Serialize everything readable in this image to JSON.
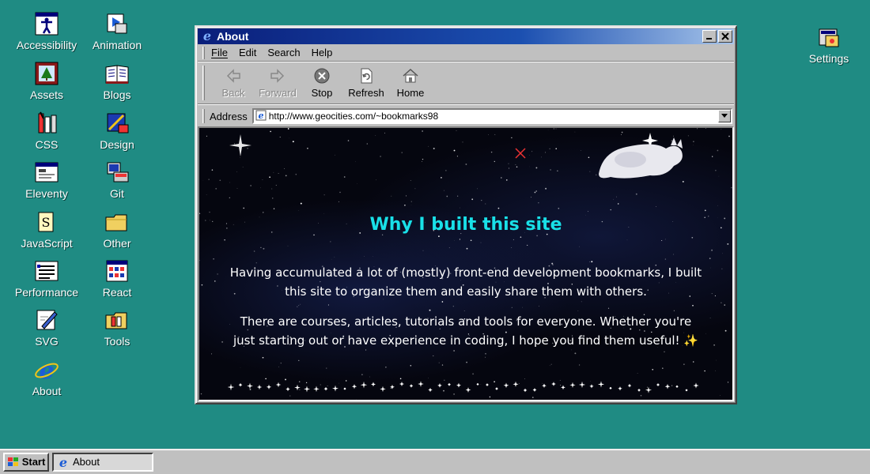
{
  "desktop": {
    "icons": [
      {
        "label": "Accessibility",
        "icon": "accessibility-icon"
      },
      {
        "label": "Animation",
        "icon": "animation-icon"
      },
      {
        "label": "Assets",
        "icon": "assets-icon"
      },
      {
        "label": "Blogs",
        "icon": "blogs-icon"
      },
      {
        "label": "CSS",
        "icon": "css-icon"
      },
      {
        "label": "Design",
        "icon": "design-icon"
      },
      {
        "label": "Eleventy",
        "icon": "eleventy-icon"
      },
      {
        "label": "Git",
        "icon": "git-icon"
      },
      {
        "label": "JavaScript",
        "icon": "javascript-icon"
      },
      {
        "label": "Other",
        "icon": "folder-icon"
      },
      {
        "label": "Performance",
        "icon": "performance-icon"
      },
      {
        "label": "React",
        "icon": "react-icon"
      },
      {
        "label": "SVG",
        "icon": "svg-icon"
      },
      {
        "label": "Tools",
        "icon": "tools-icon"
      },
      {
        "label": "About",
        "icon": "internet-explorer-icon"
      },
      {
        "label": "Settings",
        "icon": "settings-icon"
      }
    ]
  },
  "window": {
    "title": "About",
    "menu": [
      "File",
      "Edit",
      "Search",
      "Help"
    ],
    "toolbar": {
      "back": "Back",
      "forward": "Forward",
      "stop": "Stop",
      "refresh": "Refresh",
      "home": "Home"
    },
    "address": {
      "label": "Address",
      "url": "http://www.geocities.com/~bookmarks98"
    },
    "page": {
      "title": "Why I built this site",
      "paragraph1": "Having accumulated a lot of (mostly) front-end development bookmarks, I built this site to organize them and easily share them with others.",
      "paragraph2": "There are courses, articles, tutorials and tools for everyone. Whether you're just starting out or have experience in coding, I hope you find them useful! ✨"
    }
  },
  "taskbar": {
    "start": "Start",
    "task": "About"
  },
  "colors": {
    "desktop": "#1f8b83",
    "title_cyan": "#19e0e8",
    "titlebar_blue": "#0a1e7a"
  }
}
